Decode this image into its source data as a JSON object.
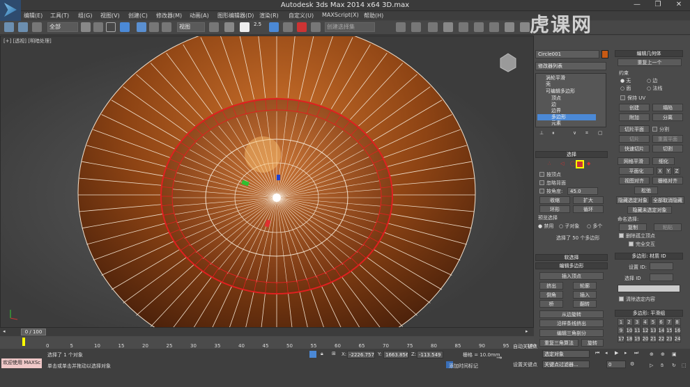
{
  "window": {
    "title": "Autodesk 3ds Max  2014 x64      3D.max",
    "controls": [
      "—",
      "❐",
      "✕"
    ]
  },
  "menu": [
    "编辑(E)",
    "工具(T)",
    "组(G)",
    "视图(V)",
    "创建(C)",
    "修改器(M)",
    "动画(A)",
    "图形编辑器(D)",
    "渲染(R)",
    "自定义(U)",
    "MAXScript(X)",
    "帮助(H)"
  ],
  "toolbar": {
    "filter_value": "全部",
    "ref_coord_value": "视图",
    "named_selection_placeholder": "创建选择集",
    "snap_value": "2.5"
  },
  "watermark": "虎课网",
  "viewport": {
    "label": "[+] [透视] [明暗处理]",
    "colors": {
      "brown": "#8a3d10",
      "wire": "#f3e3d0",
      "red": "#e02020"
    }
  },
  "command_panel": {
    "object_name": "Circle001",
    "object_color": "#c85a14",
    "modifier_list": "修改器列表",
    "stack": [
      "涡轮平滑",
      "壳",
      "可编辑多边形",
      "顶点",
      "边",
      "边界",
      "多边形",
      "元素"
    ],
    "stack_selected_index": 6,
    "selection": {
      "header": "选择",
      "by_vertex": "按顶点",
      "ignore_backfacing": "忽略背面",
      "by_angle": "按角度:",
      "angle_value": "45.0",
      "shrink": "收缩",
      "grow": "扩大",
      "ring": "环形",
      "loop": "循环",
      "preview_label": "预览选择",
      "preview_options": [
        "禁用",
        "子对象",
        "多个"
      ],
      "status": "选择了 50 个多边形"
    },
    "soft_selection_header": "软选择",
    "edit_polygons": {
      "header": "编辑多边形",
      "insert_vertex": "插入顶点",
      "buttons": [
        [
          "挤出",
          "轮廓"
        ],
        [
          "倒角",
          "插入"
        ],
        [
          "桥",
          "翻转"
        ]
      ],
      "hinge": "从边旋转",
      "extrude_spline": "沿样条线挤出",
      "edit_triangulation": "编辑三角剖分",
      "retriangulate": "重复三角算法",
      "turn": "旋转"
    },
    "edit_geometry": {
      "header": "编辑几何体",
      "repeat_last": "重复上一个",
      "constraints_label": "约束",
      "constraints": [
        "无",
        "边",
        "面",
        "法线"
      ],
      "preserve_uvs": "保持 UV",
      "create": "创建",
      "collapse": "塌陷",
      "attach": "附加",
      "detach": "分离",
      "slice_plane": "切片平面",
      "split": "分割",
      "slice": "切片",
      "reset_plane": "重置平面",
      "quickslice": "快速切片",
      "cut": "切割",
      "meshsmooth": "网格平滑",
      "tessellate": "细化",
      "make_planar": "平面化",
      "xyz": [
        "X",
        "Y",
        "Z"
      ],
      "view_align": "视图对齐",
      "grid_align": "栅格对齐",
      "relax": "松弛",
      "hide_selected": "隐藏选定对象",
      "unhide_all": "全部取消隐藏",
      "hide_unselected": "隐藏未选定对象",
      "named_selections": "命名选择:",
      "copy": "复制",
      "paste": "粘贴",
      "delete_isolated": "删除孤立顶点",
      "full_interactivity": "完全交互"
    },
    "material_ids": {
      "header": "多边形: 材质 ID",
      "set_id": "设置 ID:",
      "select_id": "选择 ID",
      "clear_selection": "清除选定内容"
    },
    "smoothing_groups": {
      "header": "多边形: 平滑组",
      "numbers": [
        "1",
        "2",
        "3",
        "4",
        "5",
        "6",
        "7",
        "8",
        "9",
        "10",
        "11",
        "12",
        "13",
        "14",
        "15",
        "16",
        "17",
        "18",
        "19",
        "20",
        "21",
        "22",
        "23",
        "24"
      ]
    }
  },
  "timeline": {
    "frame_display": "0 / 100",
    "ticks": [
      "0",
      "5",
      "10",
      "15",
      "20",
      "25",
      "30",
      "35",
      "40",
      "45",
      "50",
      "55",
      "60",
      "65",
      "70",
      "75",
      "80",
      "85",
      "90",
      "95",
      "100"
    ]
  },
  "status": {
    "welcome": "欢迎使用 MAXSc",
    "selected": "选择了 1 个对象",
    "prompt": "单击或单击并拖动以选择对象",
    "x_label": "X:",
    "x_value": "-2226.757",
    "y_label": "Y:",
    "y_value": "1663.856",
    "z_label": "Z:",
    "z_value": "-113.549",
    "grid": "栅格 = 10.0mm",
    "autokey": "自动关键点",
    "selected_dropdown": "选定对象",
    "set_key": "设置关键点",
    "key_filters": "关键点过滤器...",
    "add_time_tag": "添加时间标记",
    "frame_value": "0"
  }
}
